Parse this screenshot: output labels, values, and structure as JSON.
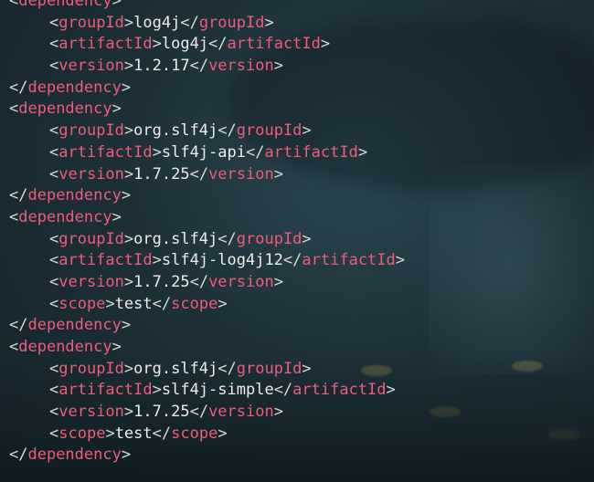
{
  "editor": {
    "blocks": [
      {
        "tag": "dependency",
        "children": [
          {
            "tag": "groupId",
            "value": "log4j"
          },
          {
            "tag": "artifactId",
            "value": "log4j"
          },
          {
            "tag": "version",
            "value": "1.2.17"
          }
        ]
      },
      {
        "tag": "dependency",
        "children": [
          {
            "tag": "groupId",
            "value": "org.slf4j"
          },
          {
            "tag": "artifactId",
            "value": "slf4j-api"
          },
          {
            "tag": "version",
            "value": "1.7.25"
          }
        ]
      },
      {
        "tag": "dependency",
        "children": [
          {
            "tag": "groupId",
            "value": "org.slf4j"
          },
          {
            "tag": "artifactId",
            "value": "slf4j-log4j12"
          },
          {
            "tag": "version",
            "value": "1.7.25"
          },
          {
            "tag": "scope",
            "value": "test"
          }
        ]
      },
      {
        "tag": "dependency",
        "children": [
          {
            "tag": "groupId",
            "value": "org.slf4j"
          },
          {
            "tag": "artifactId",
            "value": "slf4j-simple"
          },
          {
            "tag": "version",
            "value": "1.7.25"
          },
          {
            "tag": "scope",
            "value": "test"
          }
        ]
      }
    ]
  },
  "colors": {
    "tag": "#f05a7e",
    "text": "#ececec",
    "bracket": "#d8d8d8"
  }
}
